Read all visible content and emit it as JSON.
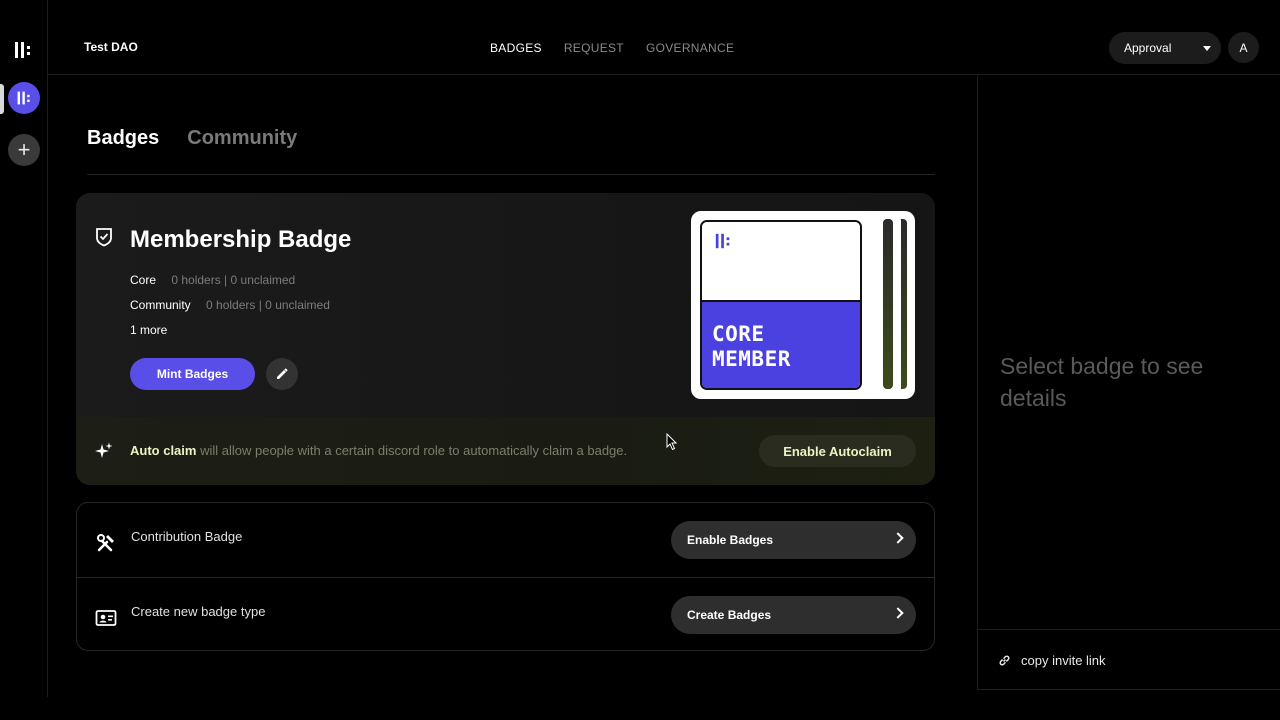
{
  "app": {
    "dao_name": "Test DAO"
  },
  "nav": {
    "items": [
      "BADGES",
      "REQUEST",
      "GOVERNANCE"
    ],
    "active": "BADGES"
  },
  "header": {
    "approval_label": "Approval",
    "avatar_initial": "A"
  },
  "tabs": {
    "badges": "Badges",
    "community": "Community"
  },
  "membership": {
    "title": "Membership Badge",
    "roles": [
      {
        "name": "Core",
        "stats": "0 holders | 0 unclaimed"
      },
      {
        "name": "Community",
        "stats": "0 holders | 0 unclaimed"
      }
    ],
    "more": "1 more",
    "mint_label": "Mint Badges",
    "badge_line1": "CORE",
    "badge_line2": "MEMBER"
  },
  "autoclaim": {
    "lead": "Auto claim",
    "text": " will allow people with a certain discord role to automatically claim a badge.",
    "button": "Enable Autoclaim"
  },
  "badge_types": [
    {
      "label": "Contribution Badge",
      "button": "Enable Badges",
      "icon": "tools-icon"
    },
    {
      "label": "Create new badge type",
      "button": "Create Badges",
      "icon": "id-card-icon"
    }
  ],
  "right_panel": {
    "empty_text": "Select badge to see details",
    "invite_label": "copy invite link"
  },
  "colors": {
    "accent": "#5a4ee8",
    "autoclaim_text": "#eef3c4"
  }
}
